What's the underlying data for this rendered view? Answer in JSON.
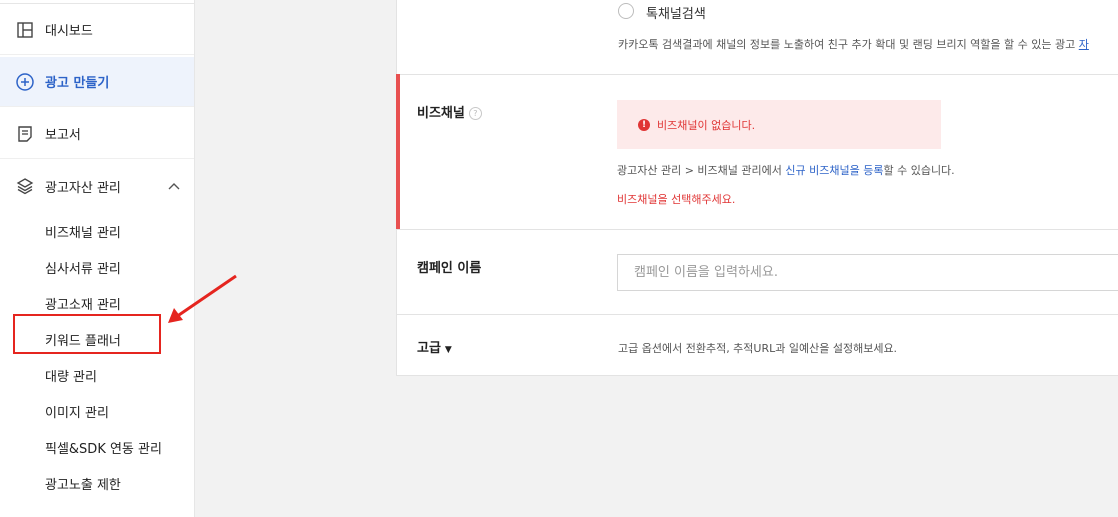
{
  "sidebar": {
    "items": [
      {
        "label": "대시보드",
        "icon": "layout-icon"
      },
      {
        "label": "광고 만들기",
        "icon": "plus-circle-icon"
      },
      {
        "label": "보고서",
        "icon": "document-icon"
      },
      {
        "label": "광고자산 관리",
        "icon": "layers-icon"
      }
    ],
    "sub_items": [
      "비즈채널 관리",
      "심사서류 관리",
      "광고소재 관리",
      "키워드 플래너",
      "대량 관리",
      "이미지 관리",
      "픽셀&SDK 연동 관리",
      "광고노출 제한"
    ]
  },
  "main": {
    "channel_search": {
      "radio_label": "톡채널검색",
      "description": "카카오톡 검색결과에 채널의 정보를 노출하여 친구 추가 확대 및 랜딩 브리지 역할을 할 수 있는 광고",
      "link_fragment": "자"
    },
    "biz_channel": {
      "label": "비즈채널",
      "help": "?",
      "alert": "비즈채널이 없습니다.",
      "info_prefix": "광고자산 관리 > 비즈채널 관리에서 ",
      "info_link": "신규 비즈채널을 등록",
      "info_suffix": "할 수 있습니다.",
      "error": "비즈채널을 선택해주세요."
    },
    "campaign_name": {
      "label": "캠페인 이름",
      "placeholder": "캠페인 이름을 입력하세요."
    },
    "advanced": {
      "label": "고급",
      "description": "고급 옵션에서 전환추적, 추적URL과 일예산을 설정해보세요."
    }
  },
  "colors": {
    "accent": "#2d63c8",
    "error": "#e03535",
    "highlight": "#e5251f"
  }
}
